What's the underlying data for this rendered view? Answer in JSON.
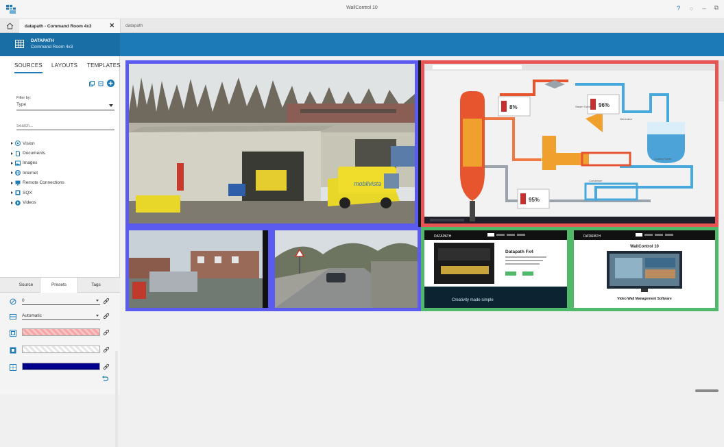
{
  "window": {
    "title": "WallControl 10",
    "help_glyph": "?",
    "settings_glyph": "☼",
    "minimize_glyph": "–",
    "maximize_glyph": "⧉"
  },
  "tabs": {
    "active_label": "datapath - Command Room 4x3",
    "close_glyph": "✕",
    "inactive_label": "datapath"
  },
  "header": {
    "title": "DATAPATH",
    "subtitle": "Command Room 4x3",
    "accent": "#1c7ab6"
  },
  "sidebar": {
    "tabs": [
      "SOURCES",
      "LAYOUTS",
      "TEMPLATES"
    ],
    "active_tab": "SOURCES",
    "filter_label": "Filter by:",
    "filter_value": "Type",
    "search_placeholder": "Search...",
    "tree": [
      {
        "label": "Vision",
        "icon": "vision-icon"
      },
      {
        "label": "Documents",
        "icon": "document-icon"
      },
      {
        "label": "Images",
        "icon": "image-icon"
      },
      {
        "label": "Internet",
        "icon": "globe-icon"
      },
      {
        "label": "Remote Connections",
        "icon": "remote-icon"
      },
      {
        "label": "SQX",
        "icon": "sqx-icon"
      },
      {
        "label": "Videos",
        "icon": "video-icon"
      }
    ]
  },
  "properties": {
    "tabs": [
      "Source",
      "Presets",
      "Tags"
    ],
    "active_tab": "Presets",
    "rotation_value": "0",
    "scaling_value": "Automatic",
    "border_color": "#f4a6a6",
    "background_color": "#ffffff",
    "fill_color": "#00008b"
  },
  "wall": {
    "windows": [
      {
        "name": "warehouse-camera",
        "border": "#5b5bef"
      },
      {
        "name": "power-plant-diagram",
        "border": "#e75454"
      },
      {
        "name": "street-camera",
        "border": "#5b5bef"
      },
      {
        "name": "road-camera",
        "border": "#5b5bef"
      },
      {
        "name": "datapath-website-fx4",
        "border": "#4fb86a"
      },
      {
        "name": "datapath-website-wallcontrol",
        "border": "#4fb86a"
      }
    ],
    "fx4_heading": "Datapath Fx4",
    "fx4_award_text": "Creativity made simple",
    "wc_heading": "WallControl 10",
    "wc_caption": "Video Wall Management Software",
    "brand": "DATAPATH",
    "van_brand": "mobilvista",
    "plant_labels": {
      "p1": "8%",
      "p2": "96%",
      "p3": "95%",
      "cooling": "Cooling Tower",
      "condenser": "Condenser",
      "turbine": "Steam Turbine",
      "generator": "Generator"
    }
  }
}
